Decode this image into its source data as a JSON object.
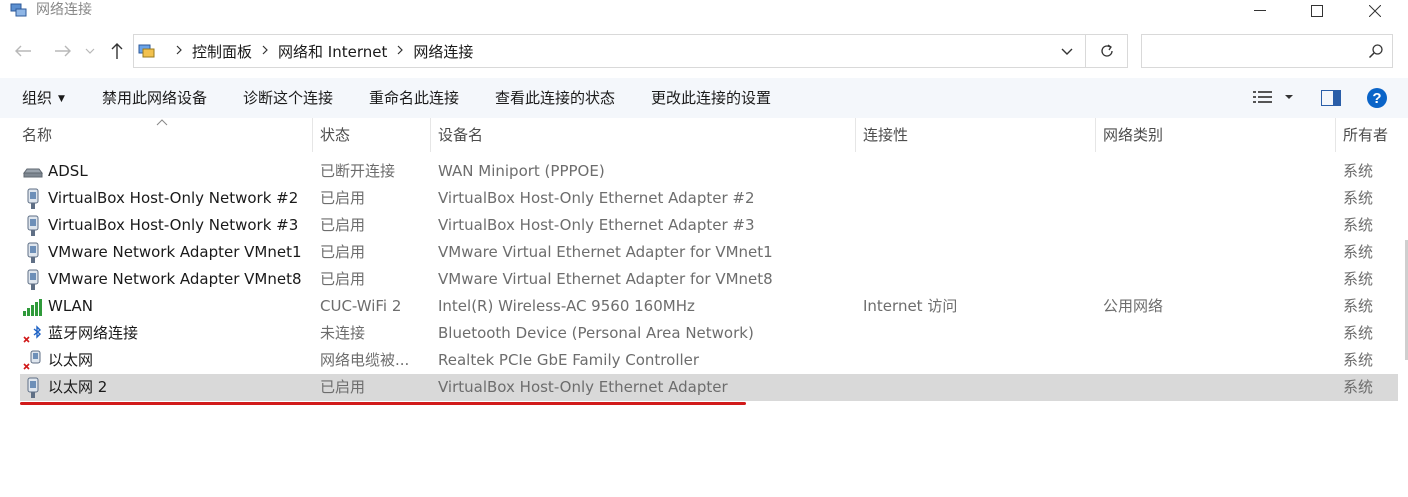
{
  "window": {
    "title": "网络连接",
    "controls": {
      "minimize": "—",
      "maximize": "☐",
      "close": "✕"
    }
  },
  "address": {
    "breadcrumbs": [
      "控制面板",
      "网络和 Internet",
      "网络连接"
    ],
    "search_placeholder": "",
    "nav": {
      "back": "←",
      "forward": "→",
      "recent": "⌄",
      "up": "↑"
    }
  },
  "toolbar": {
    "organize": "组织",
    "disable": "禁用此网络设备",
    "diagnose": "诊断这个连接",
    "rename": "重命名此连接",
    "view_status": "查看此连接的状态",
    "change_settings": "更改此连接的设置"
  },
  "columns": {
    "name": "名称",
    "status": "状态",
    "device": "设备名",
    "connectivity": "连接性",
    "category": "网络类别",
    "owner": "所有者"
  },
  "rows": [
    {
      "name": "ADSL",
      "status": "已断开连接",
      "device": "WAN Miniport (PPPOE)",
      "connectivity": "",
      "category": "",
      "owner": "系统",
      "icon": "modem-icon"
    },
    {
      "name": "VirtualBox Host-Only Network #2",
      "status": "已启用",
      "device": "VirtualBox Host-Only Ethernet Adapter #2",
      "connectivity": "",
      "category": "",
      "owner": "系统",
      "icon": "ethernet-adapter-icon"
    },
    {
      "name": "VirtualBox Host-Only Network #3",
      "status": "已启用",
      "device": "VirtualBox Host-Only Ethernet Adapter #3",
      "connectivity": "",
      "category": "",
      "owner": "系统",
      "icon": "ethernet-adapter-icon"
    },
    {
      "name": "VMware Network Adapter VMnet1",
      "status": "已启用",
      "device": "VMware Virtual Ethernet Adapter for VMnet1",
      "connectivity": "",
      "category": "",
      "owner": "系统",
      "icon": "ethernet-adapter-icon"
    },
    {
      "name": "VMware Network Adapter VMnet8",
      "status": "已启用",
      "device": "VMware Virtual Ethernet Adapter for VMnet8",
      "connectivity": "",
      "category": "",
      "owner": "系统",
      "icon": "ethernet-adapter-icon"
    },
    {
      "name": "WLAN",
      "status": "CUC-WiFi 2",
      "device": "Intel(R) Wireless-AC 9560 160MHz",
      "connectivity": "Internet 访问",
      "category": "公用网络",
      "owner": "系统",
      "icon": "wifi-signal-icon"
    },
    {
      "name": "蓝牙网络连接",
      "status": "未连接",
      "device": "Bluetooth Device (Personal Area Network)",
      "connectivity": "",
      "category": "",
      "owner": "系统",
      "icon": "bluetooth-disconnected-icon"
    },
    {
      "name": "以太网",
      "status": "网络电缆被...",
      "device": "Realtek PCIe GbE Family Controller",
      "connectivity": "",
      "category": "",
      "owner": "系统",
      "icon": "ethernet-disconnected-icon"
    },
    {
      "name": "以太网 2",
      "status": "已启用",
      "device": "VirtualBox Host-Only Ethernet Adapter",
      "connectivity": "",
      "category": "",
      "owner": "系统",
      "icon": "ethernet-adapter-icon",
      "selected": true
    }
  ],
  "colors": {
    "accent": "#0a64c8",
    "annotation": "#d11a1a",
    "selected_row": "#d9d9d9"
  }
}
